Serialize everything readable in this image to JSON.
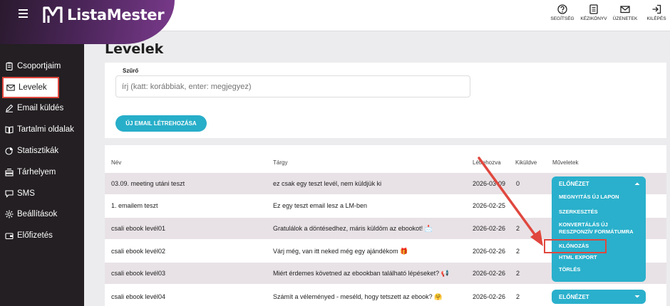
{
  "brand": {
    "name": "ListaMester"
  },
  "topbar": {
    "items": [
      {
        "label": "SEGÍTSÉG",
        "icon": "help-icon"
      },
      {
        "label": "KÉZIKÖNYV",
        "icon": "manual-icon"
      },
      {
        "label": "ÜZENETEK",
        "icon": "mail-icon"
      },
      {
        "label": "KILÉPÉS",
        "icon": "logout-icon"
      }
    ]
  },
  "sidebar": {
    "items": [
      {
        "label": "Csoportjaim",
        "icon": "clipboard-icon"
      },
      {
        "label": "Levelek",
        "icon": "envelope-icon",
        "active": true
      },
      {
        "label": "Email küldés",
        "icon": "pencil-icon"
      },
      {
        "label": "Tartalmi oldalak",
        "icon": "book-icon"
      },
      {
        "label": "Statisztikák",
        "icon": "pie-chart-icon"
      },
      {
        "label": "Tárhelyem",
        "icon": "storage-icon"
      },
      {
        "label": "SMS",
        "icon": "chat-icon"
      },
      {
        "label": "Beállítások",
        "icon": "gear-icon"
      },
      {
        "label": "Előfizetés",
        "icon": "wallet-icon"
      }
    ]
  },
  "page": {
    "title": "Levelek"
  },
  "filter": {
    "label": "Szűrő",
    "placeholder": "írj (katt: korábbiak, enter: megjegyez)",
    "new_button": "ÚJ EMAIL LÉTREHOZÁSA"
  },
  "table": {
    "headers": {
      "name": "Név",
      "subject": "Tárgy",
      "created": "Létrehozva",
      "sent": "Kiküldve",
      "actions": "Műveletek"
    },
    "rows": [
      {
        "name": "03.09. meeting utáni teszt",
        "subject": "ez csak egy teszt levél, nem küldjük ki",
        "created": "2026-03-09",
        "sent": "0"
      },
      {
        "name": "1. emailem teszt",
        "subject": "Ez egy teszt email lesz a LM-ben",
        "created": "2026-02-25",
        "sent": ""
      },
      {
        "name": "csali ebook levél01",
        "subject": "Gratulálok a döntésedhez, máris küldöm az ebookot! 📩",
        "created": "2026-02-26",
        "sent": "2"
      },
      {
        "name": "csali ebook levél02",
        "subject": "Várj még, van itt neked még egy ajándékom 🎁",
        "created": "2026-02-26",
        "sent": "2"
      },
      {
        "name": "csali ebook levél03",
        "subject": "Miért érdemes követned az ebookban található lépéseket? 📢",
        "created": "2026-02-26",
        "sent": "2"
      },
      {
        "name": "csali ebook levél04",
        "subject": "Számít a véleményed - meséld, hogy tetszett az ebook? 🤗",
        "created": "2026-02-26",
        "sent": "2"
      }
    ]
  },
  "actions_menu": {
    "head": "ELŐNÉZET",
    "items": [
      "MEGNYITÁS ÚJ LAPON",
      "SZERKESZTÉS",
      "KONVERTÁLÁS ÚJ",
      "RESZPONZÍV FORMÁTUMRA",
      "KLÓNOZÁS",
      "HTML EXPORT",
      "TÖRLÉS"
    ],
    "highlighted": "KLÓNOZÁS"
  },
  "actions_closed": {
    "head": "ELŐNÉZET"
  },
  "colors": {
    "accent": "#27aec9",
    "sidebar": "#231f22",
    "highlight": "#e0473e",
    "row_shade": "#e8e2e6"
  }
}
